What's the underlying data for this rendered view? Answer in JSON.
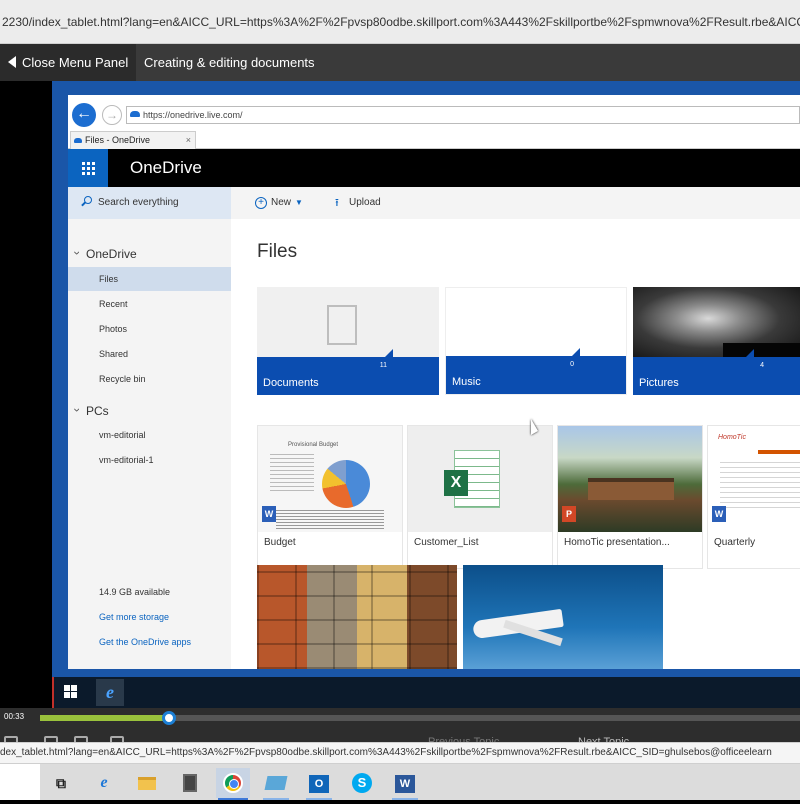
{
  "outer_browser": {
    "url_text": "2230/index_tablet.html?lang=en&AICC_URL=https%3A%2F%2Fpvsp80odbe.skillport.com%3A443%2Fskillportbe%2Fspmwnova%2FResult.rbe&AICC_SI"
  },
  "player": {
    "close_menu_label": "Close Menu Panel",
    "course_title": "Creating & editing documents",
    "time": "00:33",
    "progress_fraction": 0.17,
    "prev_label": "Previous Topic",
    "next_label": "Next Topic",
    "status_url": "dex_tablet.html?lang=en&AICC_URL=https%3A%2F%2Fpvsp80odbe.skillport.com%3A443%2Fskillportbe%2Fspmwnova%2FResult.rbe&AICC_SID=ghulsebos@officeelearn"
  },
  "inner_browser": {
    "address": "https://onedrive.live.com/",
    "tab_title": "Files - OneDrive"
  },
  "onedrive": {
    "brand": "OneDrive",
    "search_label": "Search everything",
    "toolbar": {
      "new_label": "New",
      "upload_label": "Upload"
    },
    "nav": {
      "onedrive_heading": "OneDrive",
      "items": [
        "Files",
        "Recent",
        "Photos",
        "Shared",
        "Recycle bin"
      ],
      "pcs_heading": "PCs",
      "pcs": [
        "vm-editorial",
        "vm-editorial-1"
      ],
      "storage_available": "14.9 GB available",
      "get_more_storage": "Get more storage",
      "get_apps": "Get the OneDrive apps"
    },
    "page_title": "Files",
    "folders": [
      {
        "name": "Documents",
        "count": "11"
      },
      {
        "name": "Music",
        "count": "0"
      },
      {
        "name": "Pictures",
        "count": "4"
      }
    ],
    "files": [
      {
        "name": "Budget",
        "type": "word",
        "badge": "W",
        "thumb_heading": "Provisional Budget"
      },
      {
        "name": "Customer_List",
        "type": "excel",
        "badge": "X"
      },
      {
        "name": "HomoTic presentation...",
        "type": "powerpoint",
        "badge": "P"
      },
      {
        "name": "Quarterly",
        "type": "word",
        "badge": "W",
        "thumb_heading": "HomoTic"
      }
    ]
  },
  "colors": {
    "onedrive_blue": "#0b4db0",
    "waffle_blue": "#0b64c0",
    "progress_green": "#9ac23c",
    "frame_blue": "#1a56a8"
  },
  "icons": [
    "back-arrow-icon",
    "forward-arrow-icon",
    "cloud-icon",
    "waffle-icon",
    "search-icon",
    "plus-icon",
    "upload-icon",
    "windows-start-icon",
    "ie-icon",
    "edge-icon",
    "file-explorer-icon",
    "calculator-icon",
    "chrome-icon",
    "outlook-icon",
    "skype-icon",
    "word-icon"
  ]
}
